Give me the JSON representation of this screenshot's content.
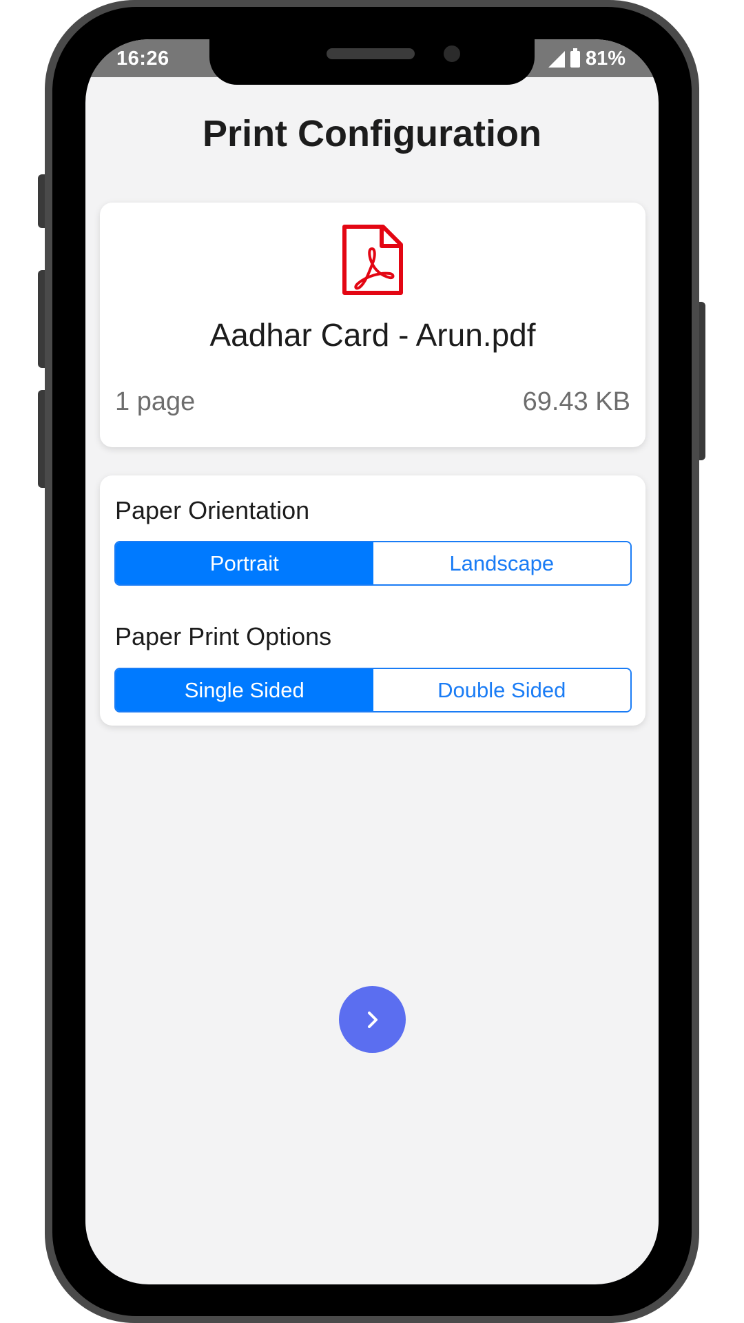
{
  "status_bar": {
    "time": "16:26",
    "battery_percent": "81%"
  },
  "page": {
    "title": "Print Configuration"
  },
  "file": {
    "icon": "pdf-file-icon",
    "name": "Aadhar Card - Arun.pdf",
    "pages": "1 page",
    "size": "69.43 KB"
  },
  "paper_orientation": {
    "label": "Paper Orientation",
    "options": [
      "Portrait",
      "Landscape"
    ],
    "selected": "Portrait"
  },
  "print_options": {
    "label": "Paper Print Options",
    "options": [
      "Single Sided",
      "Double Sided"
    ],
    "selected": "Single Sided"
  },
  "next_button": {
    "icon": "chevron-right-icon"
  },
  "colors": {
    "accent": "#007aff",
    "segment_border": "#1a7cf5",
    "next_button": "#5b6ef0",
    "pdf_icon": "#e30613",
    "background": "#f3f3f4"
  }
}
